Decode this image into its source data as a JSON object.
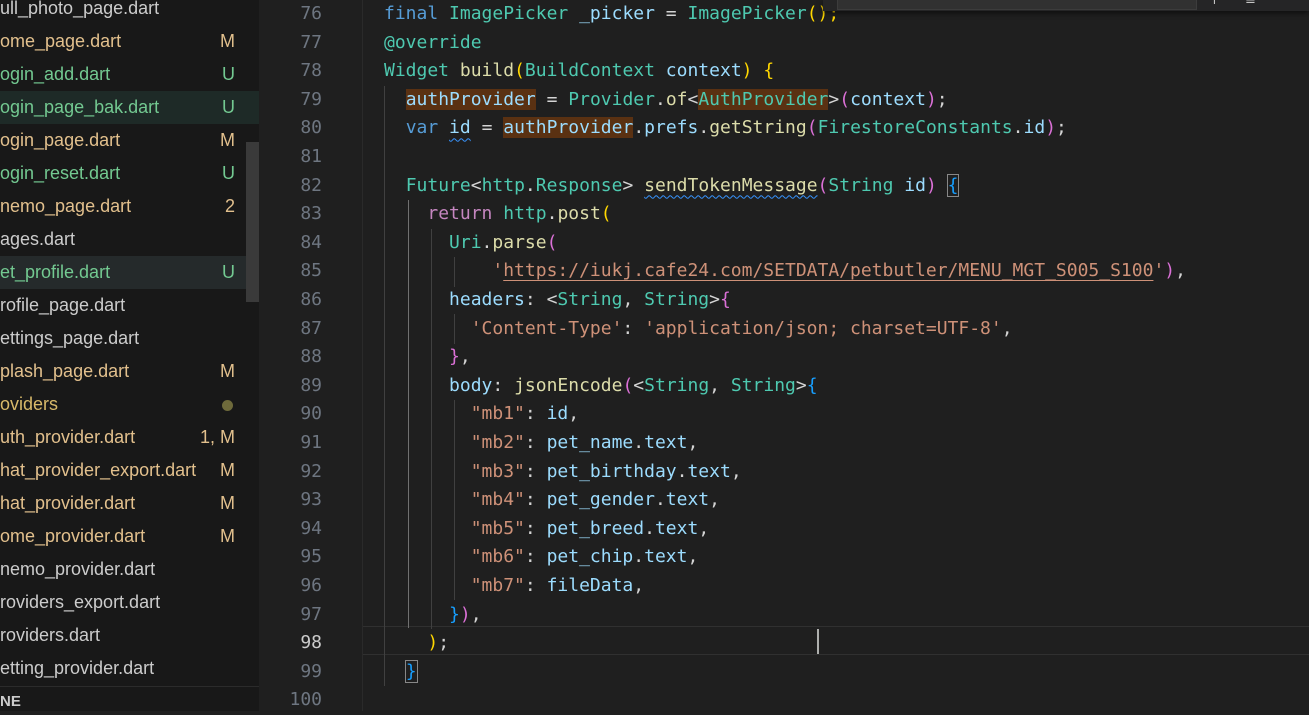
{
  "explorer": {
    "files": [
      {
        "name": "ull_photo_page.dart",
        "badge": "",
        "status": "plain"
      },
      {
        "name": "ome_page.dart",
        "badge": "M",
        "status": "mod"
      },
      {
        "name": "ogin_add.dart",
        "badge": "U",
        "status": "new"
      },
      {
        "name": "ogin_page_bak.dart",
        "badge": "U",
        "status": "new"
      },
      {
        "name": "ogin_page.dart",
        "badge": "M",
        "status": "mod"
      },
      {
        "name": "ogin_reset.dart",
        "badge": "U",
        "status": "new"
      },
      {
        "name": "nemo_page.dart",
        "badge": "2",
        "status": "mod"
      },
      {
        "name": "ages.dart",
        "badge": "",
        "status": "plain"
      },
      {
        "name": "et_profile.dart",
        "badge": "U",
        "status": "new"
      },
      {
        "name": "rofile_page.dart",
        "badge": "",
        "status": "plain"
      },
      {
        "name": "ettings_page.dart",
        "badge": "",
        "status": "plain"
      },
      {
        "name": "plash_page.dart",
        "badge": "M",
        "status": "mod"
      },
      {
        "name": "oviders",
        "badge": "",
        "status": "folder"
      },
      {
        "name": "uth_provider.dart",
        "badge": "1, M",
        "status": "mod"
      },
      {
        "name": "hat_provider_export.dart",
        "badge": "M",
        "status": "mod"
      },
      {
        "name": "hat_provider.dart",
        "badge": "M",
        "status": "mod"
      },
      {
        "name": "ome_provider.dart",
        "badge": "M",
        "status": "mod"
      },
      {
        "name": "nemo_provider.dart",
        "badge": "",
        "status": "plain"
      },
      {
        "name": "roviders_export.dart",
        "badge": "",
        "status": "plain"
      },
      {
        "name": "roviders.dart",
        "badge": "",
        "status": "plain"
      },
      {
        "name": "etting_provider.dart",
        "badge": "",
        "status": "plain"
      }
    ],
    "section_header": "NE"
  },
  "editor": {
    "line_numbers": [
      "76",
      "77",
      "78",
      "79",
      "80",
      "81",
      "82",
      "83",
      "84",
      "85",
      "86",
      "87",
      "88",
      "89",
      "90",
      "91",
      "92",
      "93",
      "94",
      "95",
      "96",
      "97",
      "98",
      "99",
      "100"
    ],
    "active_line": "98",
    "code": {
      "l76_final": "final",
      "l76_type": "ImagePicker",
      "l76_var": "_picker",
      "l76_eq": "=",
      "l76_ctor": "ImagePicker",
      "l76_end": "();",
      "l77_anno": "@override",
      "l78_type": "Widget",
      "l78_fn": "build",
      "l78_ptype": "BuildContext",
      "l78_param": "context",
      "l79_var": "authProvider",
      "l79_eq": "=",
      "l79_cls": "Provider",
      "l79_fn": "of",
      "l79_gen": "AuthProvider",
      "l79_arg": "context",
      "l80_kw": "var",
      "l80_var": "id",
      "l80_eq": "=",
      "l80_obj": "authProvider",
      "l80_prop": "prefs",
      "l80_fn": "getString",
      "l80_cls": "FirestoreConstants",
      "l80_field": "id",
      "l82_type": "Future",
      "l82_pkg": "http",
      "l82_res": "Response",
      "l82_fn": "sendTokenMessage",
      "l82_ptype": "String",
      "l82_param": "id",
      "l83_kw": "return",
      "l83_pkg": "http",
      "l83_fn": "post",
      "l84_cls": "Uri",
      "l84_fn": "parse",
      "l85_url": "https://iukj.cafe24.com/SETDATA/petbutler/MENU_MGT_S005_S100",
      "l86_key": "headers",
      "l86_t1": "String",
      "l86_t2": "String",
      "l87_key": "'Content-Type'",
      "l87_val": "'application/json; charset=UTF-8'",
      "l89_key": "body",
      "l89_fn": "jsonEncode",
      "l89_t1": "String",
      "l89_t2": "String",
      "l90_key": "\"mb1\"",
      "l90_val": "id",
      "l91_key": "\"mb2\"",
      "l91_obj": "pet_name",
      "l91_prop": "text",
      "l92_key": "\"mb3\"",
      "l92_obj": "pet_birthday",
      "l92_prop": "text",
      "l93_key": "\"mb4\"",
      "l93_obj": "pet_gender",
      "l93_prop": "text",
      "l94_key": "\"mb5\"",
      "l94_obj": "pet_breed",
      "l94_prop": "text",
      "l95_key": "\"mb6\"",
      "l95_obj": "pet_chip",
      "l95_prop": "text",
      "l96_key": "\"mb7\"",
      "l96_val": "fileData"
    }
  },
  "colors": {
    "background": "#1f1f1f",
    "sidebar": "#181818",
    "modified": "#e2c08d",
    "untracked": "#73c991",
    "keyword": "#569cd6",
    "type": "#4ec9b0",
    "function": "#dcdcaa",
    "variable": "#9cdcfe",
    "string": "#ce9178",
    "highlight": "#5a3112"
  }
}
